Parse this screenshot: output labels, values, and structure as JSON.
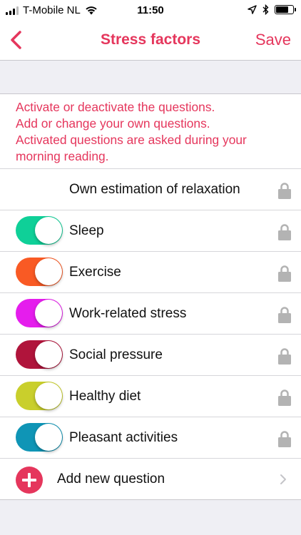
{
  "status_bar": {
    "carrier": "T-Mobile NL",
    "time": "11:50"
  },
  "nav": {
    "title": "Stress factors",
    "save_label": "Save"
  },
  "description": {
    "lines": [
      "Activate or deactivate the questions.",
      "Add or change your own questions.",
      "Activated questions are asked during your",
      "morning reading."
    ]
  },
  "questions": [
    {
      "label": "Own estimation of relaxation",
      "has_toggle": false
    },
    {
      "label": "Sleep",
      "has_toggle": true,
      "color": "#0fd098",
      "active": true
    },
    {
      "label": "Exercise",
      "has_toggle": true,
      "color": "#f95a24",
      "active": true
    },
    {
      "label": "Work-related stress",
      "has_toggle": true,
      "color": "#e51ded",
      "active": true
    },
    {
      "label": "Social pressure",
      "has_toggle": true,
      "color": "#b0143b",
      "active": true
    },
    {
      "label": "Healthy diet",
      "has_toggle": true,
      "color": "#c9cf2c",
      "active": true
    },
    {
      "label": "Pleasant activities",
      "has_toggle": true,
      "color": "#0f95b6",
      "active": true
    }
  ],
  "add_question": {
    "label": "Add new question"
  },
  "colors": {
    "accent": "#e5365c",
    "lock": "#b3b3b3"
  },
  "icons": {
    "back": "chevron-left-icon",
    "lock": "lock-icon",
    "add": "plus-circle-icon",
    "disclosure": "chevron-right-icon"
  }
}
